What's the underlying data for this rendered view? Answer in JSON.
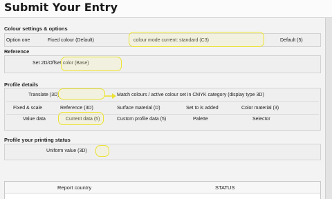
{
  "window": {
    "title": "Submit Your Entry"
  },
  "sections": {
    "colour": {
      "label": "Colour settings & options",
      "rows": [
        {
          "left": "Option one",
          "field": "Fixed colour (Default)",
          "value": "colour mode current: standard (C3)",
          "action": "Default (5)"
        }
      ]
    },
    "reference": {
      "label": "Reference",
      "rows": [
        {
          "value": "Set 2D/Offset color (Base)"
        }
      ]
    },
    "profile": {
      "label": "Profile details",
      "rows": [
        {
          "c1": "Translate (3D)",
          "c2": "Match colours / active colour set in CMYK category (display type 3D)"
        },
        {
          "c1": "Fixed & scale",
          "c2": "Reference (3D)",
          "c3": "Surface material (D)",
          "c4": "Set to is added",
          "c5": "Color material (3)"
        },
        {
          "c1": "Value data",
          "c2": "Current data (5)",
          "c3": "Custom profile data (5)",
          "c4": "Palette",
          "c5": "Selector"
        }
      ]
    },
    "profile_settings": {
      "label": "Profile your printing status",
      "rows": [
        {
          "value": "Uniform value (3D)"
        }
      ]
    }
  },
  "table": {
    "headers": [
      "Report country",
      "STATUS"
    ]
  },
  "colors": {
    "highlight": "#ece233",
    "panel_bg": "#efefef",
    "border": "#d2d2d2"
  }
}
